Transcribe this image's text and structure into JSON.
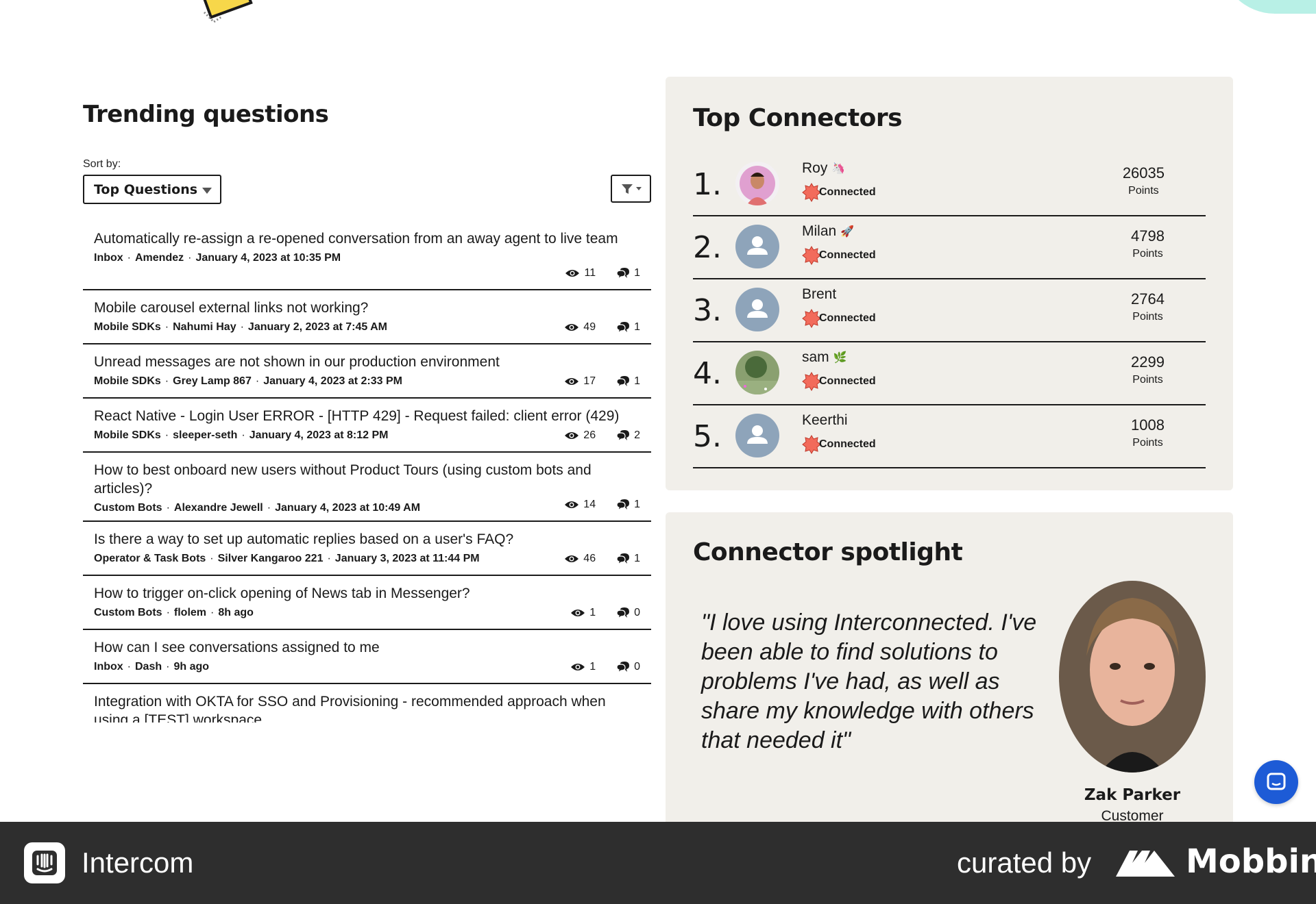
{
  "trending": {
    "title": "Trending questions",
    "sort_label": "Sort by:",
    "sort_value": "Top Questions",
    "questions": [
      {
        "title": "Automatically re-assign a re-opened conversation from an away agent to live team",
        "category": "Inbox",
        "author": "Amendez",
        "date": "January 4, 2023 at 10:35 PM",
        "views": "11",
        "replies": "1"
      },
      {
        "title": "Mobile carousel external links not working?",
        "category": "Mobile SDKs",
        "author": "Nahumi Hay",
        "date": "January 2, 2023 at 7:45 AM",
        "views": "49",
        "replies": "1"
      },
      {
        "title": "Unread messages are not shown in our production environment",
        "category": "Mobile SDKs",
        "author": "Grey Lamp 867",
        "date": "January 4, 2023 at 2:33 PM",
        "views": "17",
        "replies": "1"
      },
      {
        "title": "React Native - Login User ERROR - [HTTP 429] - Request failed: client error (429)",
        "category": "Mobile SDKs",
        "author": "sleeper-seth",
        "date": "January 4, 2023 at 8:12 PM",
        "views": "26",
        "replies": "2"
      },
      {
        "title": "How to best onboard new users without Product Tours (using custom bots and articles)?",
        "category": "Custom Bots",
        "author": "Alexandre Jewell",
        "date": "January 4, 2023 at 10:49 AM",
        "views": "14",
        "replies": "1"
      },
      {
        "title": "Is there a way to set up automatic replies based on a user's FAQ?",
        "category": "Operator & Task Bots",
        "author": "Silver Kangaroo 221",
        "date": "January 3, 2023 at 11:44 PM",
        "views": "46",
        "replies": "1"
      },
      {
        "title": "How to trigger on-click opening of News tab in Messenger?",
        "category": "Custom Bots",
        "author": "flolem",
        "date": "8h ago",
        "views": "1",
        "replies": "0"
      },
      {
        "title": "How can I see conversations assigned to me",
        "category": "Inbox",
        "author": "Dash",
        "date": "9h ago",
        "views": "1",
        "replies": "0"
      },
      {
        "title": "Integration with OKTA for SSO and Provisioning - recommended approach when using a [TEST] workspace",
        "category": "",
        "author": "",
        "date": "",
        "views": "",
        "replies": ""
      }
    ]
  },
  "connectors": {
    "title": "Top Connectors",
    "badge_label": "Connected",
    "points_label": "Points",
    "items": [
      {
        "rank": "1.",
        "name": "Roy",
        "emoji": "🦄",
        "points": "26035",
        "avatar": "photo-man"
      },
      {
        "rank": "2.",
        "name": "Milan",
        "emoji": "🚀",
        "points": "4798",
        "avatar": "default"
      },
      {
        "rank": "3.",
        "name": "Brent",
        "emoji": "",
        "points": "2764",
        "avatar": "default"
      },
      {
        "rank": "4.",
        "name": "sam",
        "emoji": "🌿",
        "points": "2299",
        "avatar": "photo-nature"
      },
      {
        "rank": "5.",
        "name": "Keerthi",
        "emoji": "",
        "points": "1008",
        "avatar": "default"
      }
    ]
  },
  "spotlight": {
    "title": "Connector spotlight",
    "quote": "\"I love using Interconnected. I've been able to find solutions to problems I've had, as well as share my knowledge with others that needed it\"",
    "name": "Zak Parker",
    "role": "Customer"
  },
  "footer": {
    "app_name": "Intercom",
    "curated_by": "curated by",
    "brand": "Mobbin"
  },
  "colors": {
    "panel_bg": "#f1efea",
    "badge": "#f26b5b",
    "avatar_default": "#8ea4ba",
    "launcher": "#1d5bd6",
    "footer_bg": "#2e2e2e"
  }
}
